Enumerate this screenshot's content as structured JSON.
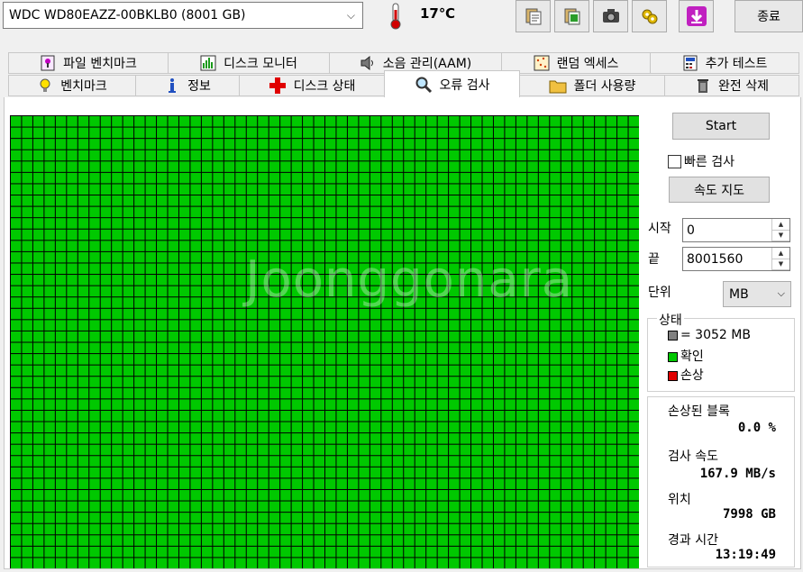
{
  "drive": {
    "selected": "WDC WD80EAZZ-00BKLB0 (8001 GB)"
  },
  "temperature": "17℃",
  "exit_label": "종료",
  "tabs_row1": [
    "파일 벤치마크",
    "디스크 모니터",
    "소음 관리(AAM)",
    "랜덤 엑세스",
    "추가 테스트"
  ],
  "tabs_row2": [
    "벤치마크",
    "정보",
    "디스크 상태",
    "오류 검사",
    "폴더 사용량",
    "완전 삭제"
  ],
  "active_tab": "오류 검사",
  "scan": {
    "start_button": "Start",
    "quick_scan_label": "빠른 검사",
    "quick_scan_checked": false,
    "speed_map_button": "속도 지도",
    "start_label": "시작",
    "start_value": "0",
    "end_label": "끝",
    "end_value": "8001560",
    "unit_label": "단위",
    "unit_value": "MB",
    "status_title": "상태",
    "legend": [
      {
        "text": "= 3052 MB",
        "color": "#808080"
      },
      {
        "text": "확인",
        "color": "#00c800"
      },
      {
        "text": "손상",
        "color": "#e00000"
      }
    ],
    "grid_color": "#00c800",
    "grid_progress_fraction": 1.0
  },
  "stats": {
    "damaged_label": "손상된 블록",
    "damaged_value": "0.0 %",
    "speed_label": "검사 속도",
    "speed_value": "167.9 MB/s",
    "position_label": "위치",
    "position_value": "7998 GB",
    "elapsed_label": "경과 시간",
    "elapsed_value": "13:19:49"
  },
  "watermark": "Joonggonara"
}
